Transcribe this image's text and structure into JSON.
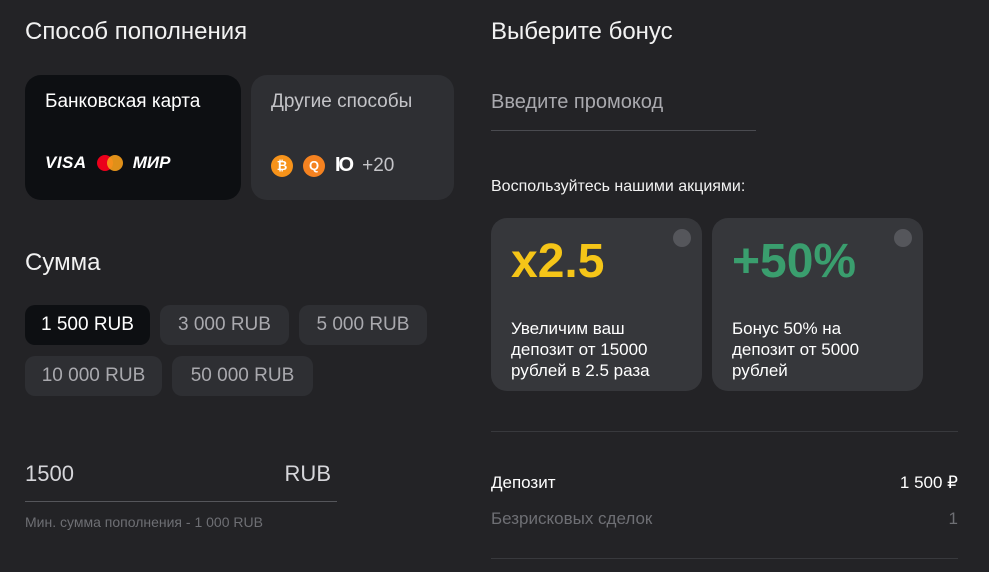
{
  "payment": {
    "heading": "Способ пополнения",
    "bank_card": {
      "label": "Банковская карта",
      "brands": [
        "VISA",
        "MasterCard",
        "МИР"
      ],
      "visa": "VISA",
      "mir": "МИР"
    },
    "other": {
      "label": "Другие способы",
      "more": "+20",
      "icons": [
        "bitcoin-icon",
        "qiwi-icon",
        "yoomoney-icon"
      ]
    }
  },
  "amount": {
    "heading": "Сумма",
    "chips": [
      "1 500 RUB",
      "3 000 RUB",
      "5 000 RUB",
      "10 000 RUB",
      "50 000 RUB"
    ],
    "selected": "1 500 RUB",
    "input_value": "1500",
    "currency": "RUB",
    "hint": "Мин. сумма пополнения - 1 000 RUB"
  },
  "bonus": {
    "heading": "Выберите бонус",
    "promo_placeholder": "Введите промокод",
    "promos_label": "Воспользуйтесь нашими акциями:",
    "offers": [
      {
        "value": "x2.5",
        "color": "#f5c518",
        "desc_lines": [
          "Увеличим ваш",
          "депозит от 15000",
          "рублей в 2.5 раза"
        ]
      },
      {
        "value": "+50%",
        "color": "#3a9e6e",
        "desc_lines": [
          "Бонус 50% на",
          "депозит от 5000",
          "рублей"
        ]
      }
    ]
  },
  "summary": {
    "deposit_label": "Депозит",
    "deposit_value": "1 500 ₽",
    "riskfree_label": "Безрисковых сделок",
    "riskfree_value": "1"
  },
  "colors": {
    "background": "#232326",
    "card": "#2e2f33",
    "selected": "#0d0f12",
    "accent_yellow": "#f5c518",
    "accent_green": "#3a9e6e"
  }
}
